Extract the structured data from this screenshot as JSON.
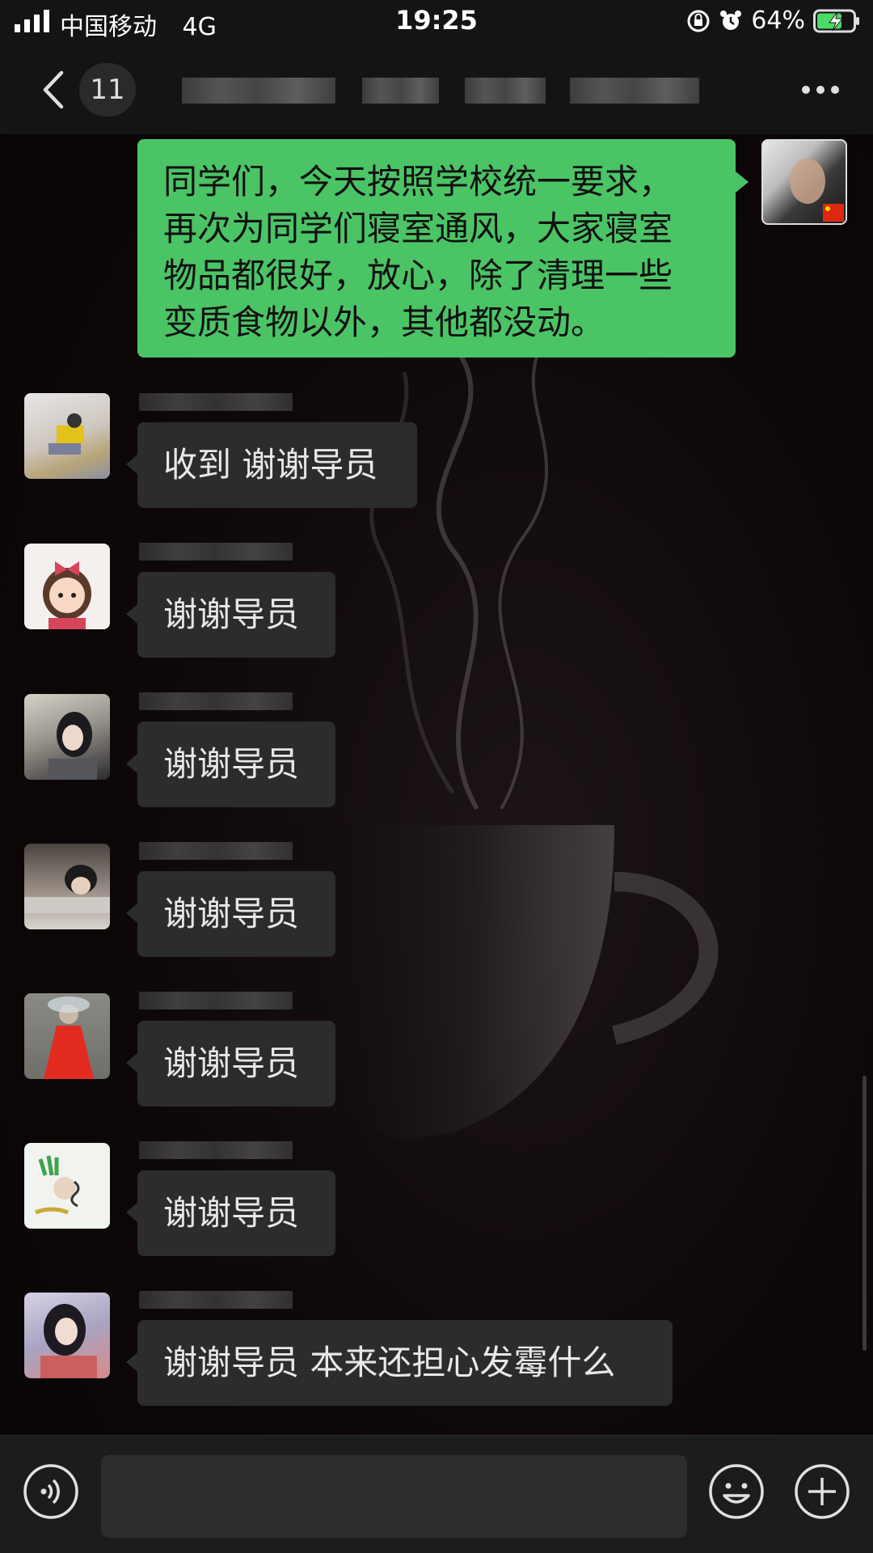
{
  "status_bar": {
    "carrier": "中国移动",
    "network": "4G",
    "time": "19:25",
    "battery_percent": "64%",
    "icons": [
      "signal-icon",
      "orientation-lock-icon",
      "alarm-icon",
      "battery-charging-icon"
    ]
  },
  "nav": {
    "unread_count": "11",
    "icons": [
      "back-icon",
      "more-icon"
    ]
  },
  "messages": [
    {
      "side": "out",
      "text_lines": [
        "同学们，今天按照学校统一要求，",
        "再次为同学们寝室通风，大家寝室",
        "物品都很好，放心，除了清理一些",
        "变质食物以外，其他都没动。"
      ]
    },
    {
      "side": "in",
      "text": "收到 谢谢导员"
    },
    {
      "side": "in",
      "text": "谢谢导员"
    },
    {
      "side": "in",
      "text": "谢谢导员"
    },
    {
      "side": "in",
      "text": "谢谢导员"
    },
    {
      "side": "in",
      "text": "谢谢导员"
    },
    {
      "side": "in",
      "text": "谢谢导员"
    },
    {
      "side": "in",
      "text": "谢谢导员 本来还担心发霉什么"
    }
  ],
  "input_bar": {
    "placeholder": "",
    "icons": [
      "voice-icon",
      "emoji-icon",
      "plus-icon"
    ]
  },
  "colors": {
    "outgoing_bubble": "#4bc466",
    "incoming_bubble": "#2c2c2c",
    "background": "#0b0607"
  }
}
